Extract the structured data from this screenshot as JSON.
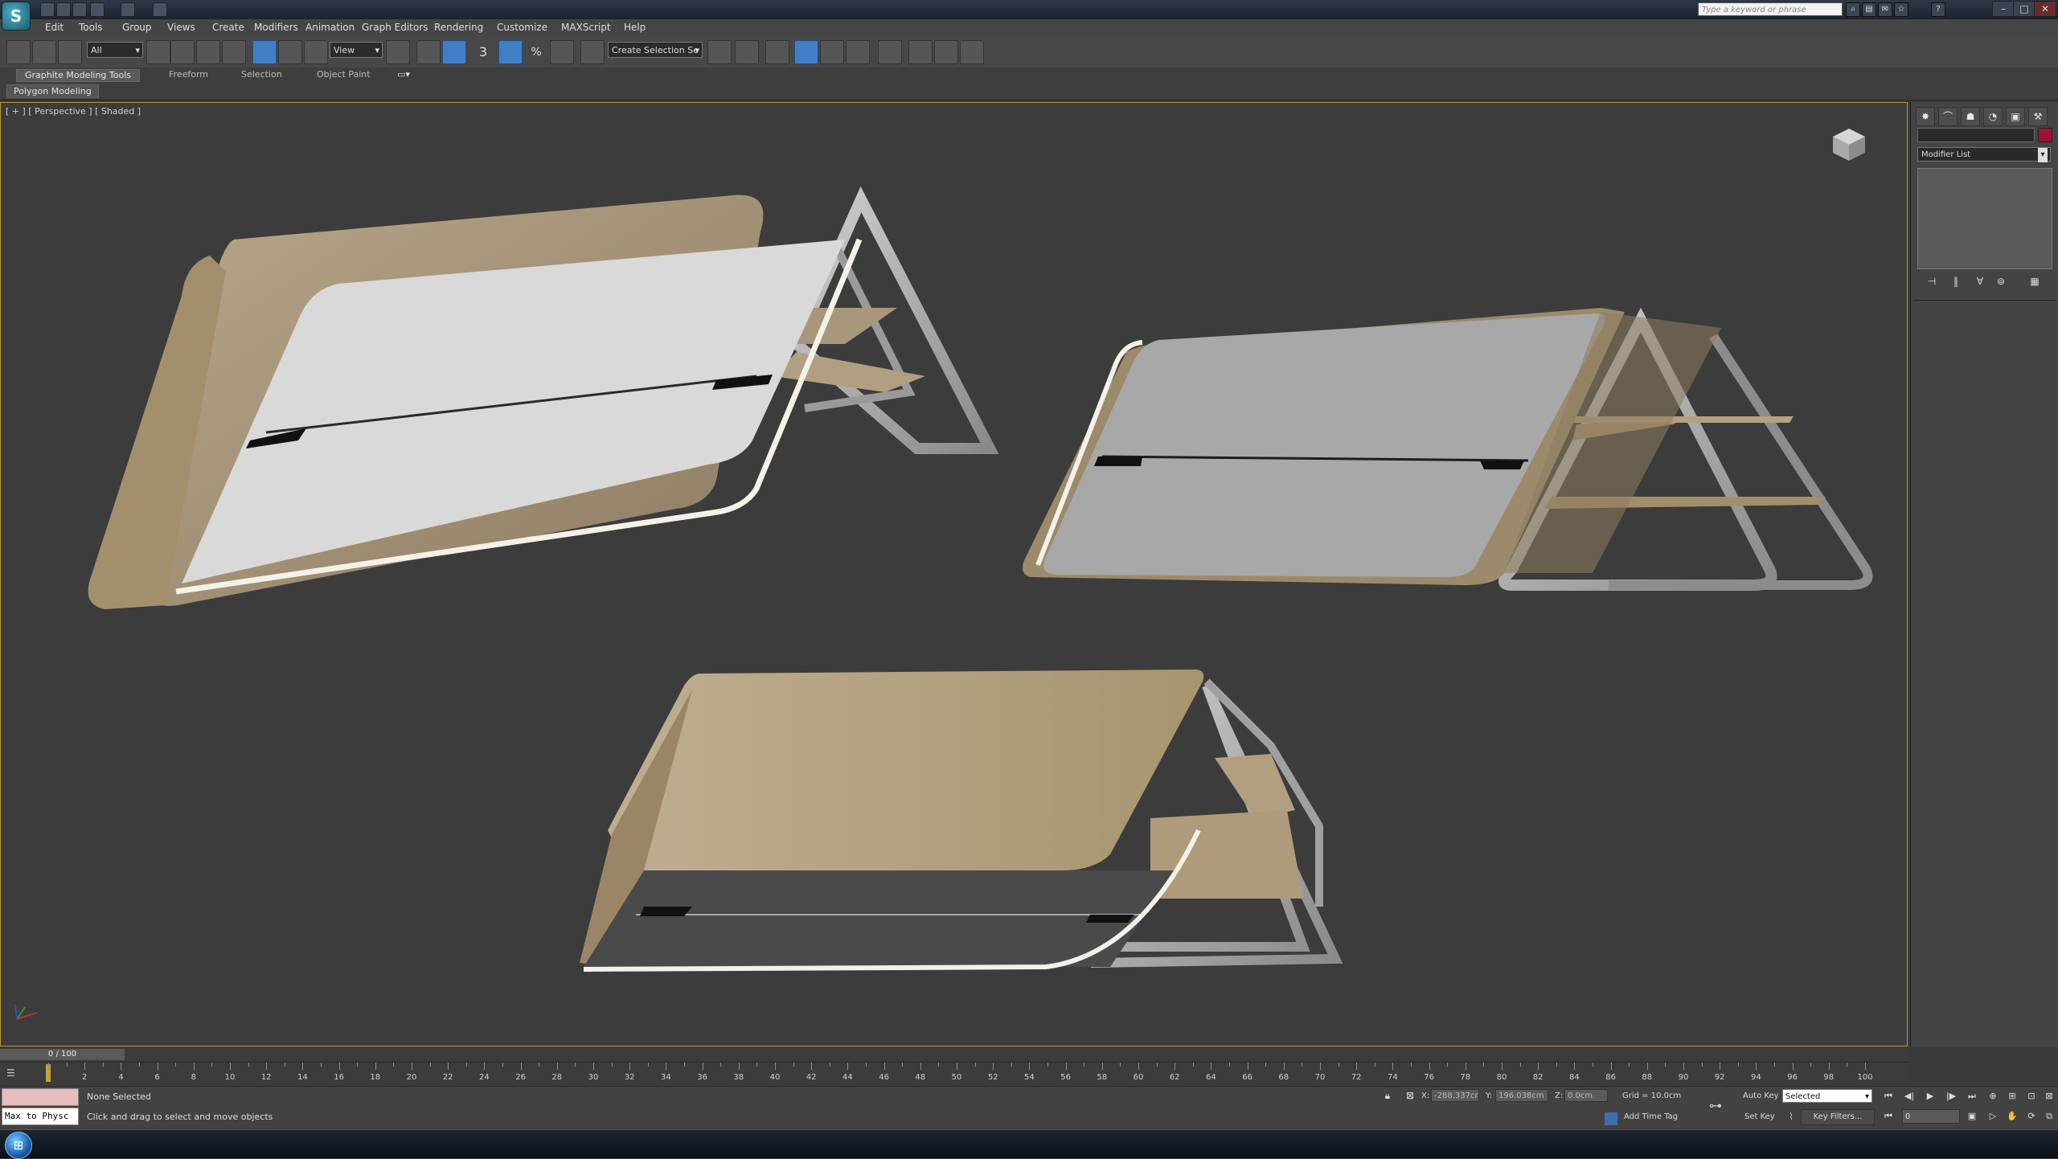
{
  "app": {
    "logo_text": "S"
  },
  "search": {
    "placeholder": "Type a keyword or phrase"
  },
  "menu": [
    "Edit",
    "Tools",
    "Group",
    "Views",
    "Create",
    "Modifiers",
    "Animation",
    "Graph Editors",
    "Rendering",
    "Customize",
    "MAXScript",
    "Help"
  ],
  "toolbar": {
    "filter_value": "All",
    "coord_system": "View",
    "named_selection": "Create Selection Se",
    "snap_label": "3",
    "angle_snap_label": "%"
  },
  "ribbon": {
    "tabs": [
      "Graphite Modeling Tools",
      "Freeform",
      "Selection",
      "Object Paint"
    ],
    "active_tab": 0,
    "panel_label": "Polygon Modeling"
  },
  "viewport": {
    "label": "[ + ] [ Perspective ] [ Shaded ]"
  },
  "command_panel": {
    "modifier_list": "Modifier List"
  },
  "timeline": {
    "frame_display": "0 / 100",
    "ticks": [
      2,
      4,
      6,
      8,
      10,
      12,
      14,
      16,
      18,
      20,
      22,
      24,
      26,
      28,
      30,
      32,
      34,
      36,
      38,
      40,
      42,
      44,
      46,
      48,
      50,
      52,
      54,
      56,
      58,
      60,
      62,
      64,
      66,
      68,
      70,
      72,
      74,
      76,
      78,
      80,
      82,
      84,
      86,
      88,
      90,
      92,
      94,
      96,
      98,
      100
    ]
  },
  "status": {
    "maxscript_text": "Max to Physc",
    "selection": "None Selected",
    "prompt": "Click and drag to select and move objects",
    "x_label": "X:",
    "x_value": "-288.337cr",
    "y_label": "Y:",
    "y_value": "196.038cm",
    "z_label": "Z:",
    "z_value": "0.0cm",
    "grid": "Grid = 10.0cm",
    "add_time_tag": "Add Time Tag",
    "auto_key": "Auto Key",
    "set_key": "Set Key",
    "selected_dropdown": "Selected",
    "key_filters": "Key Filters...",
    "current_frame": "0"
  },
  "colors": {
    "accent": "#3f7fc5",
    "viewport_border": "#b89a3a",
    "object_color": "#a01234"
  }
}
